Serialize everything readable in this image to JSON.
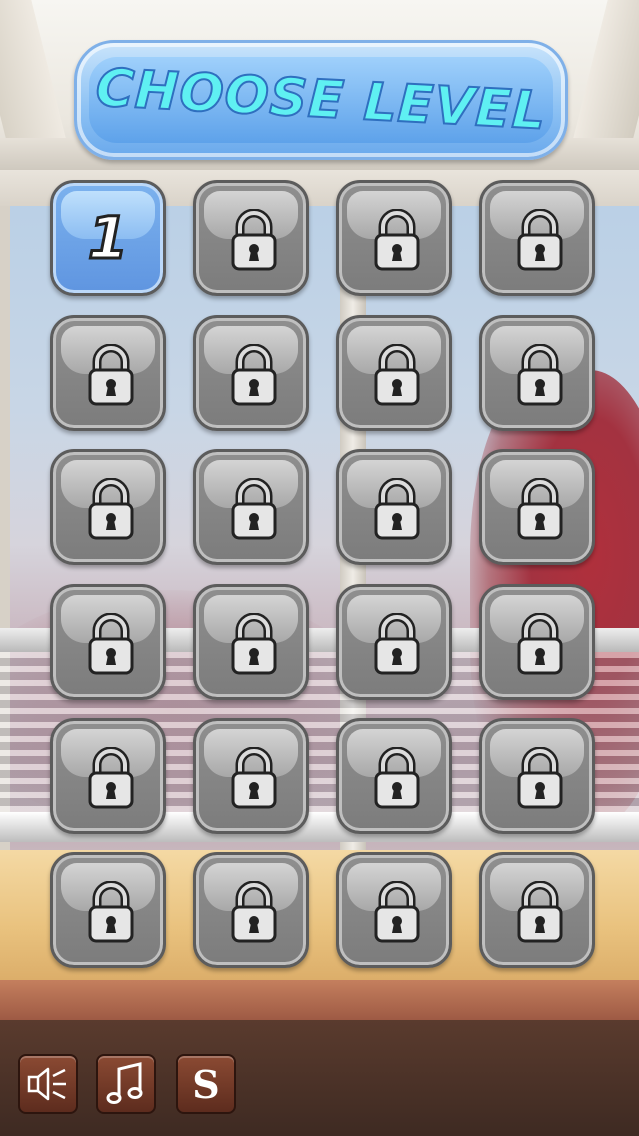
{
  "title": "CHOOSE LEVEL",
  "levels": [
    {
      "label": "1",
      "locked": false
    },
    {
      "label": "",
      "locked": true
    },
    {
      "label": "",
      "locked": true
    },
    {
      "label": "",
      "locked": true
    },
    {
      "label": "",
      "locked": true
    },
    {
      "label": "",
      "locked": true
    },
    {
      "label": "",
      "locked": true
    },
    {
      "label": "",
      "locked": true
    },
    {
      "label": "",
      "locked": true
    },
    {
      "label": "",
      "locked": true
    },
    {
      "label": "",
      "locked": true
    },
    {
      "label": "",
      "locked": true
    },
    {
      "label": "",
      "locked": true
    },
    {
      "label": "",
      "locked": true
    },
    {
      "label": "",
      "locked": true
    },
    {
      "label": "",
      "locked": true
    },
    {
      "label": "",
      "locked": true
    },
    {
      "label": "",
      "locked": true
    },
    {
      "label": "",
      "locked": true
    },
    {
      "label": "",
      "locked": true
    },
    {
      "label": "",
      "locked": true
    },
    {
      "label": "",
      "locked": true
    },
    {
      "label": "",
      "locked": true
    },
    {
      "label": "",
      "locked": true
    }
  ],
  "toolbar": {
    "sound": {
      "icon": "speaker-icon"
    },
    "music": {
      "icon": "music-note-icon"
    },
    "shop": {
      "label": "S"
    }
  },
  "colors": {
    "title_text": "#5ff0f2",
    "unlocked_tile": "#6ea3e8",
    "locked_tile": "#858585",
    "toolbar_button": "#7a3c28"
  }
}
